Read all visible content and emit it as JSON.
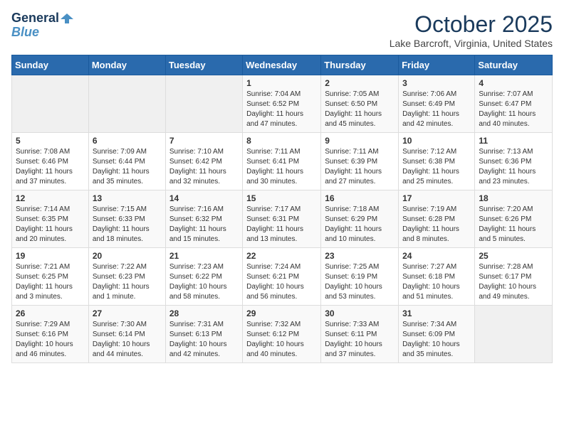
{
  "header": {
    "logo_line1": "General",
    "logo_line2": "Blue",
    "month": "October 2025",
    "location": "Lake Barcroft, Virginia, United States"
  },
  "weekdays": [
    "Sunday",
    "Monday",
    "Tuesday",
    "Wednesday",
    "Thursday",
    "Friday",
    "Saturday"
  ],
  "weeks": [
    [
      {
        "day": "",
        "info": ""
      },
      {
        "day": "",
        "info": ""
      },
      {
        "day": "",
        "info": ""
      },
      {
        "day": "1",
        "info": "Sunrise: 7:04 AM\nSunset: 6:52 PM\nDaylight: 11 hours\nand 47 minutes."
      },
      {
        "day": "2",
        "info": "Sunrise: 7:05 AM\nSunset: 6:50 PM\nDaylight: 11 hours\nand 45 minutes."
      },
      {
        "day": "3",
        "info": "Sunrise: 7:06 AM\nSunset: 6:49 PM\nDaylight: 11 hours\nand 42 minutes."
      },
      {
        "day": "4",
        "info": "Sunrise: 7:07 AM\nSunset: 6:47 PM\nDaylight: 11 hours\nand 40 minutes."
      }
    ],
    [
      {
        "day": "5",
        "info": "Sunrise: 7:08 AM\nSunset: 6:46 PM\nDaylight: 11 hours\nand 37 minutes."
      },
      {
        "day": "6",
        "info": "Sunrise: 7:09 AM\nSunset: 6:44 PM\nDaylight: 11 hours\nand 35 minutes."
      },
      {
        "day": "7",
        "info": "Sunrise: 7:10 AM\nSunset: 6:42 PM\nDaylight: 11 hours\nand 32 minutes."
      },
      {
        "day": "8",
        "info": "Sunrise: 7:11 AM\nSunset: 6:41 PM\nDaylight: 11 hours\nand 30 minutes."
      },
      {
        "day": "9",
        "info": "Sunrise: 7:11 AM\nSunset: 6:39 PM\nDaylight: 11 hours\nand 27 minutes."
      },
      {
        "day": "10",
        "info": "Sunrise: 7:12 AM\nSunset: 6:38 PM\nDaylight: 11 hours\nand 25 minutes."
      },
      {
        "day": "11",
        "info": "Sunrise: 7:13 AM\nSunset: 6:36 PM\nDaylight: 11 hours\nand 23 minutes."
      }
    ],
    [
      {
        "day": "12",
        "info": "Sunrise: 7:14 AM\nSunset: 6:35 PM\nDaylight: 11 hours\nand 20 minutes."
      },
      {
        "day": "13",
        "info": "Sunrise: 7:15 AM\nSunset: 6:33 PM\nDaylight: 11 hours\nand 18 minutes."
      },
      {
        "day": "14",
        "info": "Sunrise: 7:16 AM\nSunset: 6:32 PM\nDaylight: 11 hours\nand 15 minutes."
      },
      {
        "day": "15",
        "info": "Sunrise: 7:17 AM\nSunset: 6:31 PM\nDaylight: 11 hours\nand 13 minutes."
      },
      {
        "day": "16",
        "info": "Sunrise: 7:18 AM\nSunset: 6:29 PM\nDaylight: 11 hours\nand 10 minutes."
      },
      {
        "day": "17",
        "info": "Sunrise: 7:19 AM\nSunset: 6:28 PM\nDaylight: 11 hours\nand 8 minutes."
      },
      {
        "day": "18",
        "info": "Sunrise: 7:20 AM\nSunset: 6:26 PM\nDaylight: 11 hours\nand 5 minutes."
      }
    ],
    [
      {
        "day": "19",
        "info": "Sunrise: 7:21 AM\nSunset: 6:25 PM\nDaylight: 11 hours\nand 3 minutes."
      },
      {
        "day": "20",
        "info": "Sunrise: 7:22 AM\nSunset: 6:23 PM\nDaylight: 11 hours\nand 1 minute."
      },
      {
        "day": "21",
        "info": "Sunrise: 7:23 AM\nSunset: 6:22 PM\nDaylight: 10 hours\nand 58 minutes."
      },
      {
        "day": "22",
        "info": "Sunrise: 7:24 AM\nSunset: 6:21 PM\nDaylight: 10 hours\nand 56 minutes."
      },
      {
        "day": "23",
        "info": "Sunrise: 7:25 AM\nSunset: 6:19 PM\nDaylight: 10 hours\nand 53 minutes."
      },
      {
        "day": "24",
        "info": "Sunrise: 7:27 AM\nSunset: 6:18 PM\nDaylight: 10 hours\nand 51 minutes."
      },
      {
        "day": "25",
        "info": "Sunrise: 7:28 AM\nSunset: 6:17 PM\nDaylight: 10 hours\nand 49 minutes."
      }
    ],
    [
      {
        "day": "26",
        "info": "Sunrise: 7:29 AM\nSunset: 6:16 PM\nDaylight: 10 hours\nand 46 minutes."
      },
      {
        "day": "27",
        "info": "Sunrise: 7:30 AM\nSunset: 6:14 PM\nDaylight: 10 hours\nand 44 minutes."
      },
      {
        "day": "28",
        "info": "Sunrise: 7:31 AM\nSunset: 6:13 PM\nDaylight: 10 hours\nand 42 minutes."
      },
      {
        "day": "29",
        "info": "Sunrise: 7:32 AM\nSunset: 6:12 PM\nDaylight: 10 hours\nand 40 minutes."
      },
      {
        "day": "30",
        "info": "Sunrise: 7:33 AM\nSunset: 6:11 PM\nDaylight: 10 hours\nand 37 minutes."
      },
      {
        "day": "31",
        "info": "Sunrise: 7:34 AM\nSunset: 6:09 PM\nDaylight: 10 hours\nand 35 minutes."
      },
      {
        "day": "",
        "info": ""
      }
    ]
  ]
}
